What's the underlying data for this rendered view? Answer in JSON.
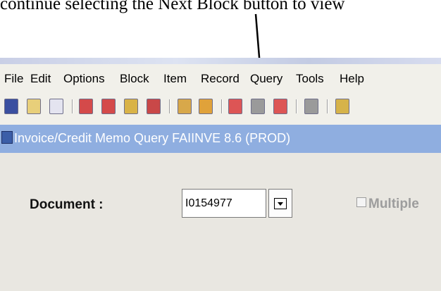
{
  "caption": "continue selecting the Next Block button to view",
  "menu": [
    "File",
    "Edit",
    "Options",
    "Block",
    "Item",
    "Record",
    "Query",
    "Tools",
    "Help"
  ],
  "toolbar": [
    {
      "name": "save-icon",
      "color": "#3a4fa0"
    },
    {
      "name": "rollback-icon",
      "color": "#e8cf7a"
    },
    {
      "name": "print-icon",
      "color": "#e4e4f0"
    },
    {
      "name": "insert-record-icon",
      "color": "#d44a4a"
    },
    {
      "name": "remove-record-icon",
      "color": "#d44a4a"
    },
    {
      "name": "enter-query-icon",
      "color": "#d9b347"
    },
    {
      "name": "execute-query-icon",
      "color": "#c94848"
    },
    {
      "name": "previous-block-icon",
      "color": "#d8a84a"
    },
    {
      "name": "next-block-icon",
      "color": "#e0a23a"
    },
    {
      "name": "help-icon",
      "color": "#d55"
    },
    {
      "name": "list-icon",
      "color": "#9a9a9a"
    },
    {
      "name": "exit-icon",
      "color": "#d55"
    },
    {
      "name": "attach-icon",
      "color": "#9a9a9a"
    },
    {
      "name": "print-2-icon",
      "color": "#d6b34a"
    }
  ],
  "window_title": "Invoice/Credit Memo Query  FAIINVE  8.6  (PROD)",
  "form": {
    "document_label": "Document :",
    "document_value": "I0154977",
    "multiple_label": "Multiple"
  }
}
